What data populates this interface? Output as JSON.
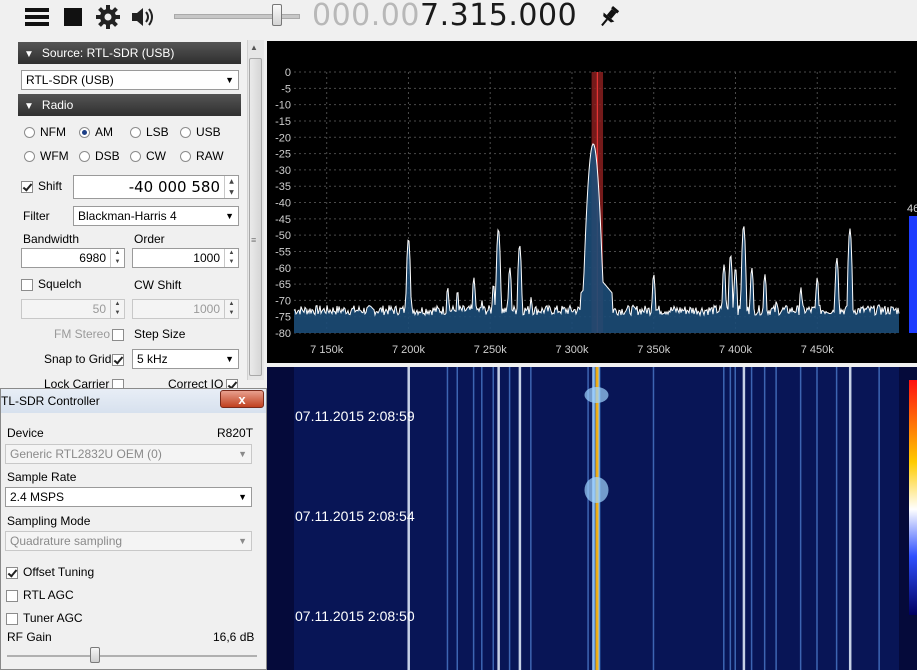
{
  "toolbar": {
    "freq_dim": "000.00",
    "freq_lit": "7.315.000",
    "volume": 0.83
  },
  "source": {
    "header": "Source: RTL-SDR (USB)",
    "device_select": "RTL-SDR (USB)"
  },
  "radio": {
    "header": "Radio",
    "modes": [
      "NFM",
      "AM",
      "LSB",
      "USB",
      "WFM",
      "DSB",
      "CW",
      "RAW"
    ],
    "selected_mode": "AM",
    "shift_label": "Shift",
    "shift_value": "-40 000 580",
    "filter_label": "Filter",
    "filter_value": "Blackman-Harris 4",
    "bandwidth_label": "Bandwidth",
    "bandwidth_value": "6980",
    "order_label": "Order",
    "order_value": "1000",
    "squelch_label": "Squelch",
    "squelch_value": "50",
    "cwshift_label": "CW Shift",
    "cwshift_value": "1000",
    "fmstereo_label": "FM Stereo",
    "stepsize_label": "Step Size",
    "snap_label": "Snap to Grid",
    "snap_value": "5 kHz",
    "lockcarrier_label": "Lock Carrier",
    "correctiq_label": "Correct IQ"
  },
  "controller": {
    "title": "TL-SDR Controller",
    "device_label": "Device",
    "device_tuner": "R820T",
    "device_value": "Generic RTL2832U OEM (0)",
    "samplerate_label": "Sample Rate",
    "samplerate_value": "2.4 MSPS",
    "samplingmode_label": "Sampling Mode",
    "samplingmode_value": "Quadrature sampling",
    "offset_tuning": "Offset Tuning",
    "rtl_agc": "RTL AGC",
    "tuner_agc": "Tuner AGC",
    "rfgain_label": "RF Gain",
    "rfgain_value": "16,6 dB",
    "close": "x"
  },
  "spectrum": {
    "y_ticks": [
      "0",
      "-5",
      "-10",
      "-15",
      "-20",
      "-25",
      "-30",
      "-35",
      "-40",
      "-45",
      "-50",
      "-55",
      "-60",
      "-65",
      "-70",
      "-75",
      "-80"
    ],
    "x_ticks": [
      "7 150k",
      "7 200k",
      "7 250k",
      "7 300k",
      "7 350k",
      "7 400k",
      "7 450k"
    ],
    "side_label": "46",
    "peaks": [
      {
        "f": 7200,
        "db": -51
      },
      {
        "f": 7224,
        "db": -66
      },
      {
        "f": 7230,
        "db": -67
      },
      {
        "f": 7240,
        "db": -63
      },
      {
        "f": 7245,
        "db": -70
      },
      {
        "f": 7252,
        "db": -65
      },
      {
        "f": 7255,
        "db": -48
      },
      {
        "f": 7262,
        "db": -60
      },
      {
        "f": 7268,
        "db": -53
      },
      {
        "f": 7275,
        "db": -69
      },
      {
        "f": 7313,
        "db": -22
      },
      {
        "f": 7316,
        "db": -49
      },
      {
        "f": 7310,
        "db": -64
      },
      {
        "f": 7350,
        "db": -62
      },
      {
        "f": 7393,
        "db": -59
      },
      {
        "f": 7397,
        "db": -56
      },
      {
        "f": 7400,
        "db": -60
      },
      {
        "f": 7405,
        "db": -47
      },
      {
        "f": 7410,
        "db": -60
      },
      {
        "f": 7418,
        "db": -62
      },
      {
        "f": 7425,
        "db": -70
      },
      {
        "f": 7440,
        "db": -66
      },
      {
        "f": 7450,
        "db": -63
      },
      {
        "f": 7462,
        "db": -57
      },
      {
        "f": 7470,
        "db": -48
      },
      {
        "f": 7488,
        "db": -71
      }
    ]
  },
  "waterfall": {
    "timestamps": [
      "07.11.2015 2:08:59",
      "07.11.2015 2:08:54",
      "07.11.2015 2:08:50"
    ]
  },
  "colors": {
    "trace": "#ffffff",
    "fill": "#1c4d78",
    "band": "#8a1f1f",
    "waterfall_bg": "#050a3a"
  }
}
